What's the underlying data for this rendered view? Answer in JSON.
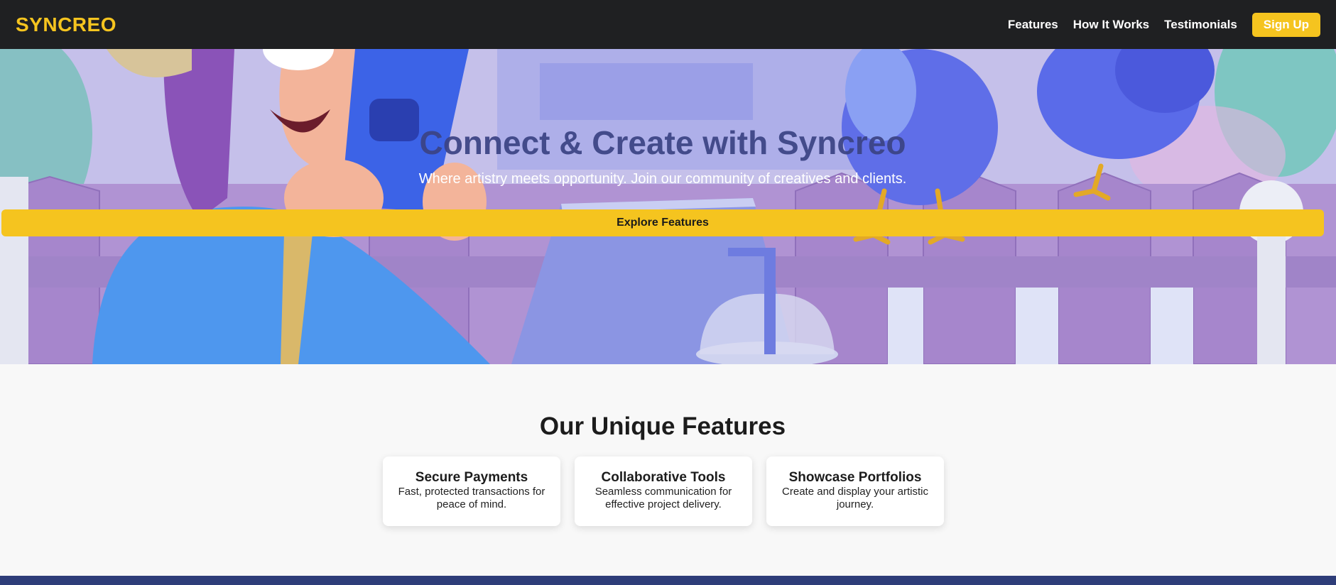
{
  "nav": {
    "logo": "SYNCREO",
    "links": [
      "Features",
      "How It Works",
      "Testimonials"
    ],
    "signup_label": "Sign Up"
  },
  "hero": {
    "title": "Connect & Create with Syncreo",
    "subtitle": "Where artistry meets opportunity. Join our community of creatives and clients.",
    "cta_label": "Explore Features"
  },
  "features": {
    "title": "Our Unique Features",
    "cards": [
      {
        "title": "Secure Payments",
        "desc": "Fast, protected transactions for peace of mind."
      },
      {
        "title": "Collaborative Tools",
        "desc": "Seamless communication for effective project delivery."
      },
      {
        "title": "Showcase Portfolios",
        "desc": "Create and display your artistic journey."
      }
    ]
  },
  "colors": {
    "accent": "#f5c41f",
    "nav_bg": "#1f2022",
    "hero_title": "#3b4384",
    "footer": "#2e3d79"
  }
}
